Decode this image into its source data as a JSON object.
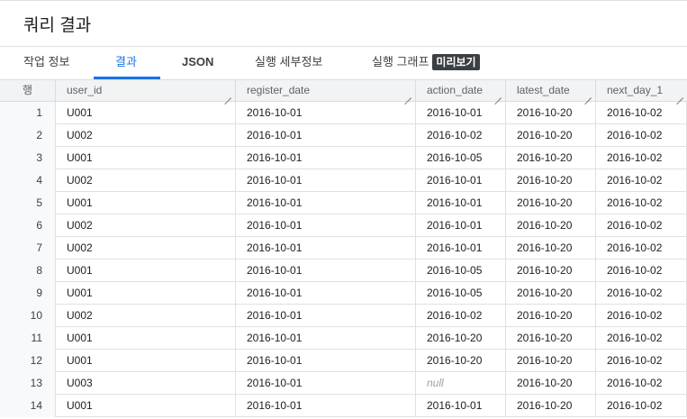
{
  "title": "쿼리 결과",
  "tabs": [
    {
      "label": "작업 정보"
    },
    {
      "label": "결과"
    },
    {
      "label": "JSON"
    },
    {
      "label": "실행 세부정보"
    },
    {
      "label": "실행 그래프"
    }
  ],
  "preview_badge": "미리보기",
  "columns": [
    "행",
    "user_id",
    "register_date",
    "action_date",
    "latest_date",
    "next_day_1"
  ],
  "rows": [
    {
      "n": "1",
      "user_id": "U001",
      "register_date": "2016-10-01",
      "action_date": "2016-10-01",
      "latest_date": "2016-10-20",
      "next_day_1": "2016-10-02"
    },
    {
      "n": "2",
      "user_id": "U002",
      "register_date": "2016-10-01",
      "action_date": "2016-10-02",
      "latest_date": "2016-10-20",
      "next_day_1": "2016-10-02"
    },
    {
      "n": "3",
      "user_id": "U001",
      "register_date": "2016-10-01",
      "action_date": "2016-10-05",
      "latest_date": "2016-10-20",
      "next_day_1": "2016-10-02"
    },
    {
      "n": "4",
      "user_id": "U002",
      "register_date": "2016-10-01",
      "action_date": "2016-10-01",
      "latest_date": "2016-10-20",
      "next_day_1": "2016-10-02"
    },
    {
      "n": "5",
      "user_id": "U001",
      "register_date": "2016-10-01",
      "action_date": "2016-10-01",
      "latest_date": "2016-10-20",
      "next_day_1": "2016-10-02"
    },
    {
      "n": "6",
      "user_id": "U002",
      "register_date": "2016-10-01",
      "action_date": "2016-10-01",
      "latest_date": "2016-10-20",
      "next_day_1": "2016-10-02"
    },
    {
      "n": "7",
      "user_id": "U002",
      "register_date": "2016-10-01",
      "action_date": "2016-10-01",
      "latest_date": "2016-10-20",
      "next_day_1": "2016-10-02"
    },
    {
      "n": "8",
      "user_id": "U001",
      "register_date": "2016-10-01",
      "action_date": "2016-10-05",
      "latest_date": "2016-10-20",
      "next_day_1": "2016-10-02"
    },
    {
      "n": "9",
      "user_id": "U001",
      "register_date": "2016-10-01",
      "action_date": "2016-10-05",
      "latest_date": "2016-10-20",
      "next_day_1": "2016-10-02"
    },
    {
      "n": "10",
      "user_id": "U002",
      "register_date": "2016-10-01",
      "action_date": "2016-10-02",
      "latest_date": "2016-10-20",
      "next_day_1": "2016-10-02"
    },
    {
      "n": "11",
      "user_id": "U001",
      "register_date": "2016-10-01",
      "action_date": "2016-10-20",
      "latest_date": "2016-10-20",
      "next_day_1": "2016-10-02"
    },
    {
      "n": "12",
      "user_id": "U001",
      "register_date": "2016-10-01",
      "action_date": "2016-10-20",
      "latest_date": "2016-10-20",
      "next_day_1": "2016-10-02"
    },
    {
      "n": "13",
      "user_id": "U003",
      "register_date": "2016-10-01",
      "action_date": "null",
      "latest_date": "2016-10-20",
      "next_day_1": "2016-10-02"
    },
    {
      "n": "14",
      "user_id": "U001",
      "register_date": "2016-10-01",
      "action_date": "2016-10-01",
      "latest_date": "2016-10-20",
      "next_day_1": "2016-10-02"
    }
  ]
}
